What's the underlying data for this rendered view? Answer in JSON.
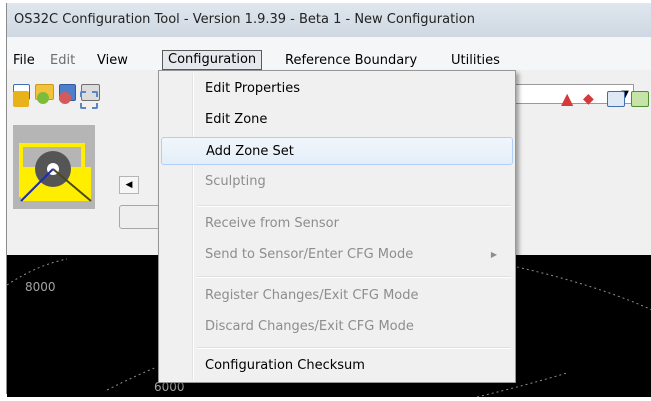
{
  "window": {
    "title": "OS32C Configuration Tool - Version 1.9.39 - Beta 1 - New Configuration"
  },
  "menubar": {
    "items": [
      "File",
      "Edit",
      "View",
      "Configuration",
      "Reference Boundary",
      "Utilities"
    ]
  },
  "configuration_menu": {
    "items": [
      {
        "label": "Edit Properties",
        "enabled": true
      },
      {
        "label": "Edit Zone",
        "enabled": true
      },
      {
        "label": "Add Zone Set",
        "enabled": true,
        "hover": true
      },
      {
        "label": "Sculpting",
        "enabled": false
      },
      {
        "label": "Receive from Sensor",
        "enabled": false
      },
      {
        "label": "Send to Sensor/Enter CFG Mode",
        "enabled": false,
        "submenu": true
      },
      {
        "label": "Register Changes/Exit CFG Mode",
        "enabled": false
      },
      {
        "label": "Discard Changes/Exit CFG Mode",
        "enabled": false
      },
      {
        "label": "Configuration Checksum",
        "enabled": true
      }
    ]
  },
  "plot": {
    "labels": [
      "8000",
      "6000"
    ]
  },
  "toolbar": {
    "icons": [
      "new-icon",
      "open-folder-icon",
      "save-icon",
      "print-icon",
      "add-point-icon",
      "zoom-in-icon",
      "zoom-out-icon",
      "zoom-box-icon",
      "red-arrow-icon",
      "red-shape-icon",
      "grid-icon",
      "image-icon"
    ]
  },
  "colors": {
    "menu_hover_border": "#aecff7",
    "sensor_yellow": "#ffee00",
    "plot_background": "#000000"
  }
}
